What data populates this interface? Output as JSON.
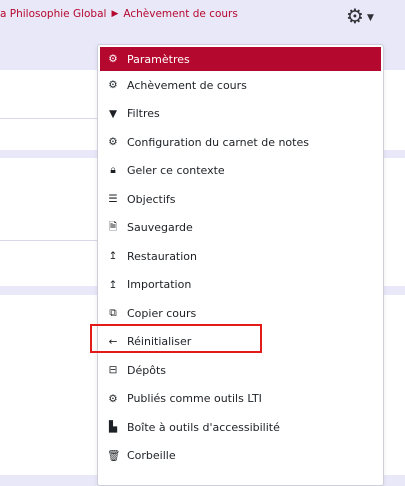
{
  "breadcrumb": {
    "course": "a Philosophie Global",
    "current": "Achèvement de cours"
  },
  "menu": {
    "items": [
      {
        "label": "Paramètres",
        "icon": "gear-icon"
      },
      {
        "label": "Achèvement de cours",
        "icon": "gear-icon"
      },
      {
        "label": "Filtres",
        "icon": "filter-icon"
      },
      {
        "label": "Configuration du carnet de notes",
        "icon": "gear-icon"
      },
      {
        "label": "Geler ce contexte",
        "icon": "lock-icon"
      },
      {
        "label": "Objectifs",
        "icon": "list-icon"
      },
      {
        "label": "Sauvegarde",
        "icon": "file-icon"
      },
      {
        "label": "Restauration",
        "icon": "upload-icon"
      },
      {
        "label": "Importation",
        "icon": "upload-icon"
      },
      {
        "label": "Copier cours",
        "icon": "copy-icon"
      },
      {
        "label": "Réinitialiser",
        "icon": "arrow-left-icon"
      },
      {
        "label": "Dépôts",
        "icon": "repository-icon"
      },
      {
        "label": "Publiés comme outils LTI",
        "icon": "gear-icon"
      },
      {
        "label": "Boîte à outils d'accessibilité",
        "icon": "chart-icon"
      },
      {
        "label": "Corbeille",
        "icon": "trash-icon"
      },
      {
        "label": "",
        "icon": ""
      }
    ]
  },
  "colors": {
    "accent": "#b5082e",
    "highlight": "#e21a1a",
    "background": "#e9e8f9"
  }
}
